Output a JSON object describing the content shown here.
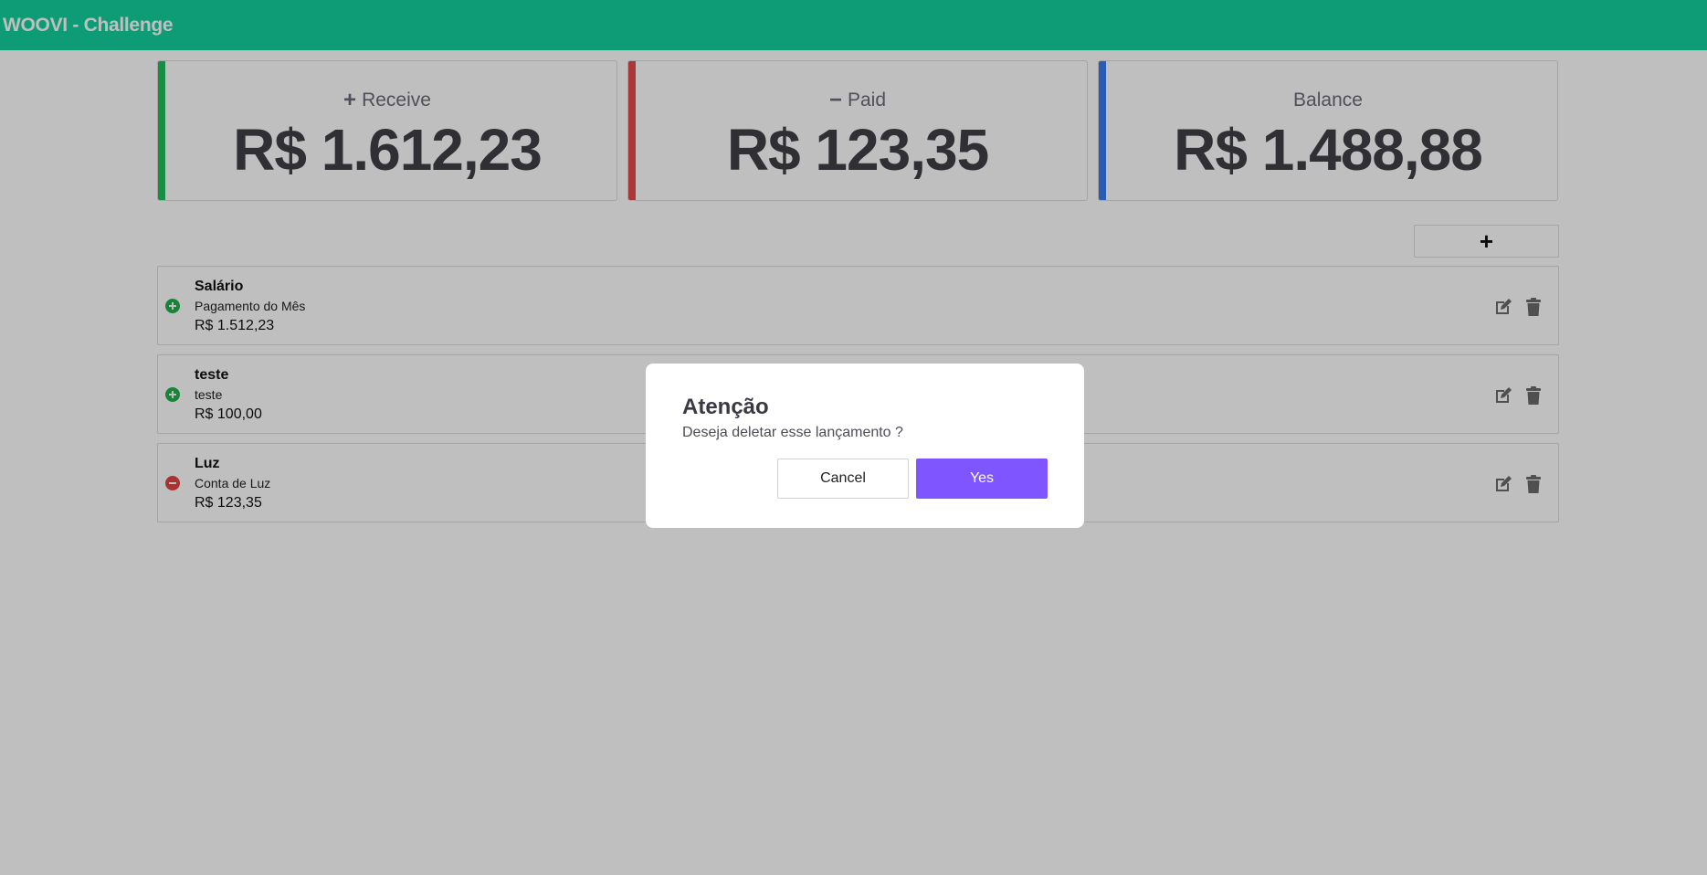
{
  "header": {
    "title": "WOOVI - Challenge"
  },
  "summary": {
    "receive": {
      "symbol": "+",
      "label": "Receive",
      "value": "R$ 1.612,23",
      "accent": "#1fbf5a"
    },
    "paid": {
      "symbol": "−",
      "label": "Paid",
      "value": "R$ 123,35",
      "accent": "#e34b4b"
    },
    "balance": {
      "label": "Balance",
      "value": "R$ 1.488,88",
      "accent": "#3a7bf2"
    }
  },
  "toolbar": {
    "add_label": "+"
  },
  "entries": [
    {
      "type": "income",
      "icon": "plus-circle-icon",
      "title": "Salário",
      "description": "Pagamento do Mês",
      "amount": "R$ 1.512,23"
    },
    {
      "type": "income",
      "icon": "plus-circle-icon",
      "title": "teste",
      "description": "teste",
      "amount": "R$ 100,00"
    },
    {
      "type": "expense",
      "icon": "minus-circle-icon",
      "title": "Luz",
      "description": "Conta de Luz",
      "amount": "R$ 123,35"
    }
  ],
  "colors": {
    "header": "#12d19c",
    "income": "#22b14c",
    "expense": "#e04545",
    "primary": "#7f55ff",
    "action_icon": "#6b6b6b"
  },
  "modal": {
    "title": "Atenção",
    "message": "Deseja deletar esse lançamento ?",
    "cancel_label": "Cancel",
    "confirm_label": "Yes"
  }
}
